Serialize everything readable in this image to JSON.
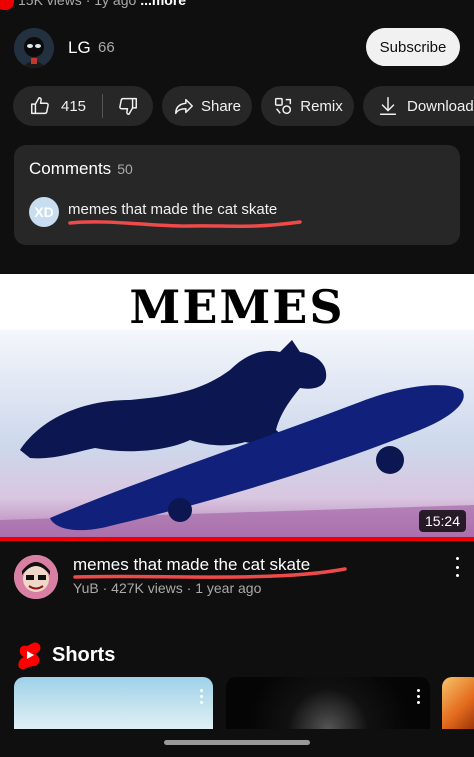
{
  "top": {
    "partial_text": "15K views · 1y ago",
    "more_label": "...more"
  },
  "channel": {
    "name": "LG",
    "subscriber_count": "66",
    "subscribe_label": "Subscribe"
  },
  "actions": {
    "like_count": "415",
    "share_label": "Share",
    "remix_label": "Remix",
    "download_label": "Download"
  },
  "comments": {
    "title": "Comments",
    "count": "50",
    "avatar_initials": "XD",
    "first_comment": "memes that made the cat skate"
  },
  "thumbnail": {
    "caption_text": "MEMES",
    "duration": "15:24",
    "progress_fraction": 1.0
  },
  "video": {
    "title": "memes that made the cat skate",
    "channel": "YuB",
    "meta": "427K views · 1 year ago"
  },
  "shorts": {
    "label": "Shorts"
  },
  "colors": {
    "accent": "#ff0000",
    "background": "#0f0f0f",
    "pill": "#272727",
    "annotation": "#ee4a4a"
  }
}
